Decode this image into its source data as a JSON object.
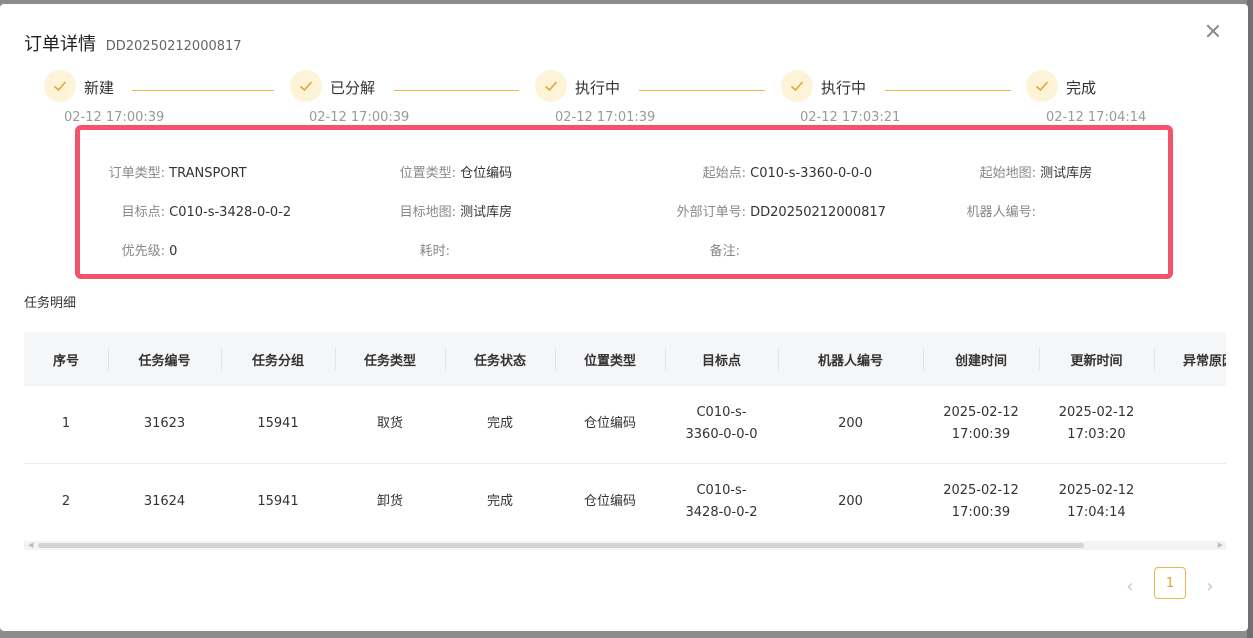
{
  "modal": {
    "title": "订单详情",
    "order_no": "DD20250212000817"
  },
  "steps": [
    {
      "label": "新建",
      "time": "02-12 17:00:39"
    },
    {
      "label": "已分解",
      "time": "02-12 17:00:39"
    },
    {
      "label": "执行中",
      "time": "02-12 17:01:39"
    },
    {
      "label": "执行中",
      "time": "02-12 17:03:21"
    },
    {
      "label": "完成",
      "time": "02-12 17:04:14"
    }
  ],
  "info": {
    "order_type": {
      "label": "订单类型:",
      "value": "TRANSPORT"
    },
    "location_type": {
      "label": "位置类型:",
      "value": "仓位编码"
    },
    "start_point": {
      "label": "起始点:",
      "value": "C010-s-3360-0-0-0"
    },
    "start_map": {
      "label": "起始地图:",
      "value": "测试库房"
    },
    "target_point": {
      "label": "目标点:",
      "value": "C010-s-3428-0-0-2"
    },
    "target_map": {
      "label": "目标地图:",
      "value": "测试库房"
    },
    "external_order": {
      "label": "外部订单号:",
      "value": "DD20250212000817"
    },
    "robot_no": {
      "label": "机器人编号:",
      "value": ""
    },
    "priority": {
      "label": "优先级:",
      "value": "0"
    },
    "duration": {
      "label": "耗时:",
      "value": ""
    },
    "remark": {
      "label": "备注:",
      "value": ""
    }
  },
  "task_section_title": "任务明细",
  "table": {
    "headers": [
      "序号",
      "任务编号",
      "任务分组",
      "任务类型",
      "任务状态",
      "位置类型",
      "目标点",
      "机器人编号",
      "创建时间",
      "更新时间",
      "异常原因"
    ],
    "rows": [
      {
        "index": "1",
        "task_no": "31623",
        "group": "15941",
        "type": "取货",
        "status": "完成",
        "loc_type": "仓位编码",
        "target_a": "C010-s-",
        "target_b": "3360-0-0-0",
        "robot": "200",
        "created_date": "2025-02-12",
        "created_time": "17:00:39",
        "updated_date": "2025-02-12",
        "updated_time": "17:03:20",
        "error": ""
      },
      {
        "index": "2",
        "task_no": "31624",
        "group": "15941",
        "type": "卸货",
        "status": "完成",
        "loc_type": "仓位编码",
        "target_a": "C010-s-",
        "target_b": "3428-0-0-2",
        "robot": "200",
        "created_date": "2025-02-12",
        "created_time": "17:00:39",
        "updated_date": "2025-02-12",
        "updated_time": "17:04:14",
        "error": ""
      }
    ]
  },
  "pagination": {
    "current_page": "1",
    "prev_glyph": "‹",
    "next_glyph": "›"
  },
  "colors": {
    "accent": "#e6b84a",
    "highlight_border": "#f2546b",
    "step_bg": "#fdf3d9"
  }
}
